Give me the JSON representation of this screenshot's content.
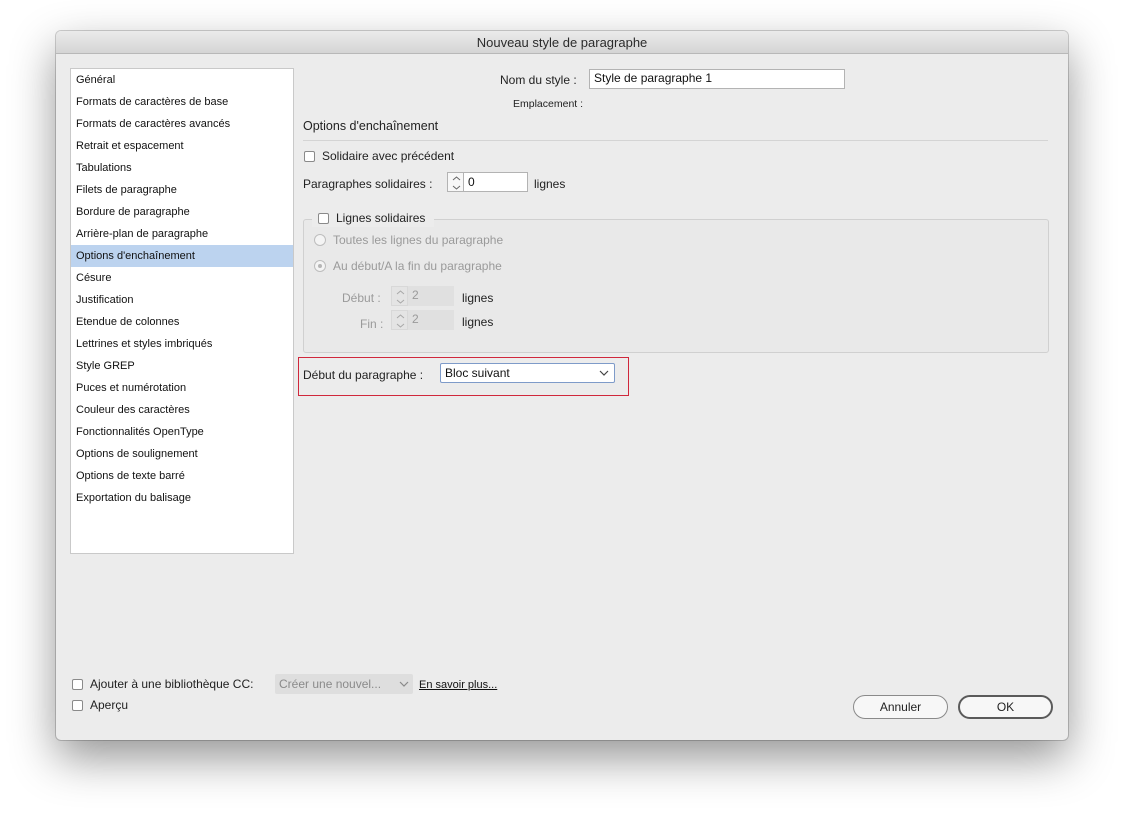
{
  "window": {
    "title": "Nouveau style de paragraphe"
  },
  "sidebar": {
    "items": [
      {
        "label": "Général"
      },
      {
        "label": "Formats de caractères de base"
      },
      {
        "label": "Formats de caractères avancés"
      },
      {
        "label": "Retrait et espacement"
      },
      {
        "label": "Tabulations"
      },
      {
        "label": "Filets de paragraphe"
      },
      {
        "label": "Bordure de paragraphe"
      },
      {
        "label": "Arrière-plan de paragraphe"
      },
      {
        "label": "Options d'enchaînement",
        "selected": true
      },
      {
        "label": "Césure"
      },
      {
        "label": "Justification"
      },
      {
        "label": "Etendue de colonnes"
      },
      {
        "label": "Lettrines et styles imbriqués"
      },
      {
        "label": "Style GREP"
      },
      {
        "label": "Puces et numérotation"
      },
      {
        "label": "Couleur des caractères"
      },
      {
        "label": "Fonctionnalités OpenType"
      },
      {
        "label": "Options de soulignement"
      },
      {
        "label": "Options de texte barré"
      },
      {
        "label": "Exportation du balisage"
      }
    ]
  },
  "main": {
    "style_name_label": "Nom du style :",
    "style_name_value": "Style de paragraphe 1",
    "location_label": "Emplacement :",
    "section_title": "Options d'enchaînement",
    "keep_with_previous_label": "Solidaire avec précédent",
    "keep_with_next_label": "Paragraphes solidaires :",
    "keep_with_next_value": "0",
    "keep_with_next_unit": "lignes",
    "keep_lines_label": "Lignes solidaires",
    "all_lines_label": "Toutes les lignes du paragraphe",
    "start_end_label": "Au début/A la fin du paragraphe",
    "start_label": "Début :",
    "start_value": "2",
    "start_unit": "lignes",
    "end_label": "Fin :",
    "end_value": "2",
    "end_unit": "lignes",
    "start_paragraph_label": "Début du paragraphe :",
    "start_paragraph_value": "Bloc suivant"
  },
  "footer": {
    "cc_library_label": "Ajouter à une bibliothèque CC:",
    "cc_library_placeholder": "Créer une nouvel...",
    "learn_more_label": "En savoir plus...",
    "preview_label": "Aperçu",
    "cancel_label": "Annuler",
    "ok_label": "OK"
  },
  "colors": {
    "selection": "#bcd3ef",
    "highlight_border": "#d0283c"
  }
}
